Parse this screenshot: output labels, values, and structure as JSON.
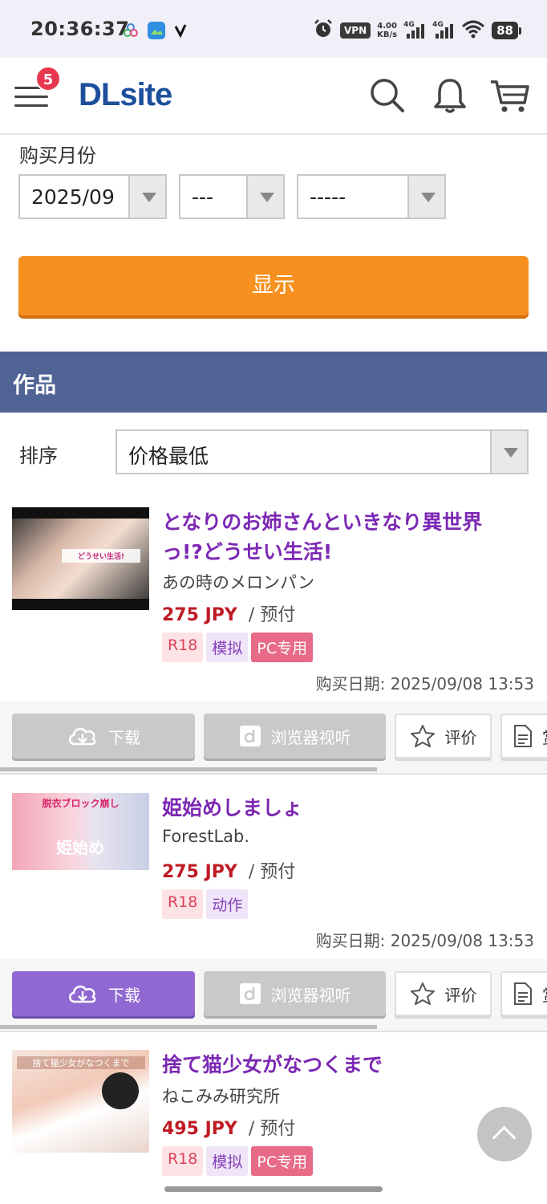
{
  "status_bar": {
    "time": "20:36:37",
    "vpn": "VPN",
    "speed_value": "4.00",
    "speed_unit": "KB/s",
    "network_1": "4G",
    "network_2": "4G",
    "battery": "88"
  },
  "header": {
    "menu_badge": "5",
    "logo": "DLsite",
    "icons": [
      "search-icon",
      "bell-icon",
      "cart-icon"
    ]
  },
  "filters": {
    "label": "购买月份",
    "month_value": "2025/09",
    "day_value": "---",
    "third_value": "-----",
    "show_button": "显示"
  },
  "section": {
    "title": "作品",
    "sort_label": "排序",
    "sort_value": "价格最低"
  },
  "items": [
    {
      "title": "となりのお姉さんといきなり異世界っ!?どうせい生活!",
      "maker": "あの時のメロンパン",
      "price": "275 JPY",
      "payment": "/ 预付",
      "tags": [
        "R18",
        "模拟",
        "PC专用"
      ],
      "purchase_date": "购买日期: 2025/09/08 13:53",
      "thumb_text": "どうせい生活!"
    },
    {
      "title": "姫始めしましょ",
      "maker": "ForestLab.",
      "price": "275 JPY",
      "payment": "/ 预付",
      "tags": [
        "R18",
        "动作"
      ],
      "purchase_date": "购买日期: 2025/09/08 13:53",
      "thumb_text": "脱衣ブロック崩し"
    },
    {
      "title": "捨て猫少女がなつくまで",
      "maker": "ねこみみ研究所",
      "price": "495 JPY",
      "payment": "/ 预付",
      "tags": [
        "R18",
        "模拟",
        "PC专用"
      ],
      "thumb_text": "捨て猫少女がなつくまで"
    }
  ],
  "actions": {
    "download": "下载",
    "browser_view": "浏览器视听",
    "review": "评价",
    "appreciate": "赏"
  },
  "colors": {
    "accent_orange": "#f7901e",
    "section_blue": "#506395",
    "title_purple": "#7c28b4",
    "price_red": "#bf1b24",
    "download_active": "#9068d2"
  }
}
